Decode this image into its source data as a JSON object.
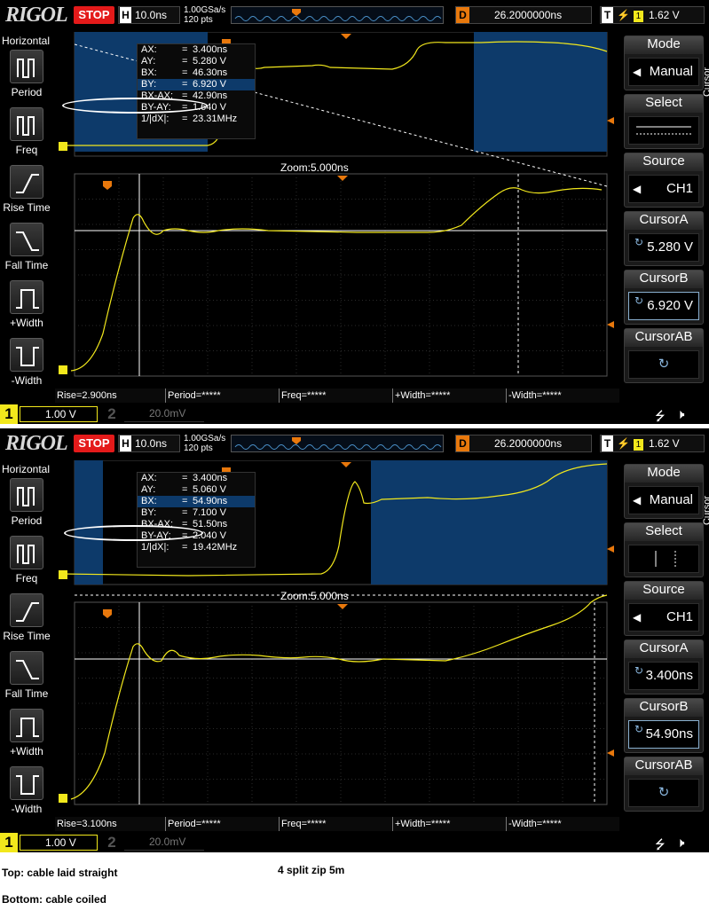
{
  "scopes": [
    {
      "header": {
        "logo": "RIGOL",
        "run_state": "STOP",
        "h_label": "H",
        "timebase": "10.0ns",
        "sample_rate": "1.00GSa/s",
        "mem_depth": "120 pts",
        "delay_label": "D",
        "delay": "26.2000000ns",
        "trig_label": "T",
        "trig_channel": "1",
        "trig_level": "1.62 V"
      },
      "left_menu": {
        "title": "Horizontal",
        "items": [
          "Period",
          "Freq",
          "Rise Time",
          "Fall Time",
          "+Width",
          "-Width"
        ]
      },
      "cursor_readout": [
        {
          "k": "AX:",
          "v": "3.400ns"
        },
        {
          "k": "AY:",
          "v": "5.280 V"
        },
        {
          "k": "BX:",
          "v": "46.30ns"
        },
        {
          "k": "BY:",
          "v": "6.920 V"
        },
        {
          "k": "BX-AX:",
          "v": "42.90ns"
        },
        {
          "k": "BY-AY:",
          "v": "1.640 V"
        },
        {
          "k": "1/|dX|:",
          "v": "23.31MHz"
        }
      ],
      "highlighted_row": 3,
      "zoom_label": "Zoom:5.000ns",
      "measurements": [
        "Rise=2.900ns",
        "Period=*****",
        "Freq=*****",
        "+Width=*****",
        "-Width=*****"
      ],
      "ch1": {
        "num": "1",
        "scale": "1.00 V"
      },
      "ch2": {
        "num": "2",
        "scale": "20.0mV"
      },
      "right_menu": {
        "side_label": "Cursor",
        "mode_title": "Mode",
        "mode_value": "Manual",
        "select_title": "Select",
        "source_title": "Source",
        "source_value": "CH1",
        "cursorA_title": "CursorA",
        "cursorA_value": "5.280 V",
        "cursorB_title": "CursorB",
        "cursorB_value": "6.920 V",
        "cursorAB_title": "CursorAB"
      }
    },
    {
      "header": {
        "logo": "RIGOL",
        "run_state": "STOP",
        "h_label": "H",
        "timebase": "10.0ns",
        "sample_rate": "1.00GSa/s",
        "mem_depth": "120 pts",
        "delay_label": "D",
        "delay": "26.2000000ns",
        "trig_label": "T",
        "trig_channel": "1",
        "trig_level": "1.62 V"
      },
      "left_menu": {
        "title": "Horizontal",
        "items": [
          "Period",
          "Freq",
          "Rise Time",
          "Fall Time",
          "+Width",
          "-Width"
        ]
      },
      "cursor_readout": [
        {
          "k": "AX:",
          "v": "3.400ns"
        },
        {
          "k": "AY:",
          "v": "5.060 V"
        },
        {
          "k": "BX:",
          "v": "54.90ns"
        },
        {
          "k": "BY:",
          "v": "7.100 V"
        },
        {
          "k": "BX-AX:",
          "v": "51.50ns"
        },
        {
          "k": "BY-AY:",
          "v": "2.040 V"
        },
        {
          "k": "1/|dX|:",
          "v": "19.42MHz"
        }
      ],
      "highlighted_row": 2,
      "zoom_label": "Zoom:5.000ns",
      "measurements": [
        "Rise=3.100ns",
        "Period=*****",
        "Freq=*****",
        "+Width=*****",
        "-Width=*****"
      ],
      "ch1": {
        "num": "1",
        "scale": "1.00 V"
      },
      "ch2": {
        "num": "2",
        "scale": "20.0mV"
      },
      "right_menu": {
        "side_label": "Cursor",
        "mode_title": "Mode",
        "mode_value": "Manual",
        "select_title": "Select",
        "source_title": "Source",
        "source_value": "CH1",
        "cursorA_title": "CursorA",
        "cursorA_value": "3.400ns",
        "cursorB_title": "CursorB",
        "cursorB_value": "54.90ns",
        "cursorAB_title": "CursorAB"
      }
    }
  ],
  "captions": {
    "top": "Top: cable laid straight",
    "bottom": "Bottom: cable coiled",
    "title": "4 split zip 5m"
  },
  "colors": {
    "trace": "#f2e81c",
    "marker": "#e8780c",
    "window": "#0d3a6a",
    "stop": "#e41a1a"
  },
  "icons": [
    "usb-icon",
    "speaker-icon"
  ]
}
